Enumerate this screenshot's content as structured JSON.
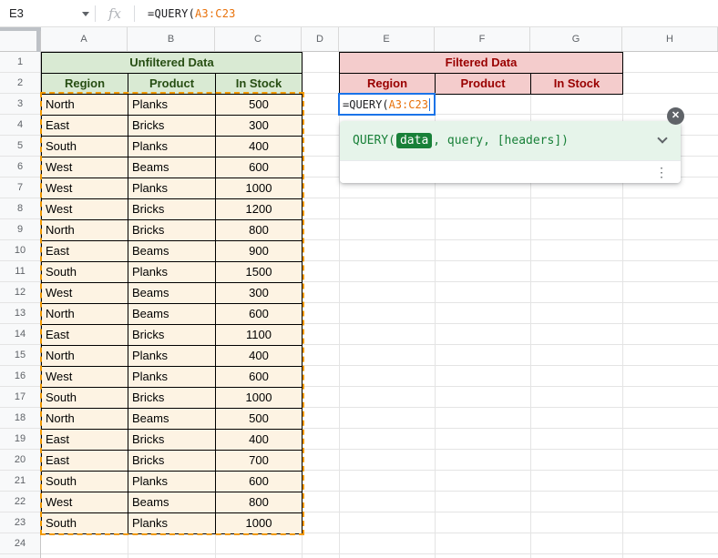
{
  "formula_bar": {
    "cell_reference": "E3",
    "fx_label": "fx",
    "formula": {
      "prefix": "=QUERY(",
      "range": "A3:C23"
    }
  },
  "grid": {
    "column_letters": [
      "A",
      "B",
      "C",
      "D",
      "E",
      "F",
      "G",
      "H"
    ],
    "row_numbers": [
      1,
      2,
      3,
      4,
      5,
      6,
      7,
      8,
      9,
      10,
      11,
      12,
      13,
      14,
      15,
      16,
      17,
      18,
      19,
      20,
      21,
      22,
      23,
      24
    ]
  },
  "unfiltered_table": {
    "title": "Unfiltered Data",
    "headers": [
      "Region",
      "Product",
      "In Stock"
    ],
    "rows": [
      [
        "North",
        "Planks",
        500
      ],
      [
        "East",
        "Bricks",
        300
      ],
      [
        "South",
        "Planks",
        400
      ],
      [
        "West",
        "Beams",
        600
      ],
      [
        "West",
        "Planks",
        1000
      ],
      [
        "West",
        "Bricks",
        1200
      ],
      [
        "North",
        "Bricks",
        800
      ],
      [
        "East",
        "Beams",
        900
      ],
      [
        "South",
        "Planks",
        1500
      ],
      [
        "West",
        "Beams",
        300
      ],
      [
        "North",
        "Beams",
        600
      ],
      [
        "East",
        "Bricks",
        1100
      ],
      [
        "North",
        "Planks",
        400
      ],
      [
        "West",
        "Planks",
        600
      ],
      [
        "South",
        "Bricks",
        1000
      ],
      [
        "North",
        "Beams",
        500
      ],
      [
        "East",
        "Bricks",
        400
      ],
      [
        "East",
        "Bricks",
        700
      ],
      [
        "South",
        "Planks",
        600
      ],
      [
        "West",
        "Beams",
        800
      ],
      [
        "South",
        "Planks",
        1000
      ]
    ]
  },
  "filtered_table": {
    "title": "Filtered Data",
    "headers": [
      "Region",
      "Product",
      "In Stock"
    ]
  },
  "cell_editor": {
    "prefix": "=QUERY(",
    "range": "A3:C23"
  },
  "formula_help": {
    "function_name": "QUERY(",
    "active_argument": "data",
    "arguments_rest": ", query, [headers])",
    "close_label": "✕",
    "menu_icon": "⋮"
  },
  "colors": {
    "accent_blue": "#1a73e8",
    "range_reference_text": "#e8710a",
    "range_border_orange": "#f29900",
    "range_fill": "#fdf3e3",
    "green_header_bg": "#d9ead3",
    "green_header_text": "#274e13",
    "red_header_bg": "#f4cccc",
    "red_header_text": "#990000",
    "help_banner_bg": "#e6f4ea",
    "help_green": "#188038"
  }
}
